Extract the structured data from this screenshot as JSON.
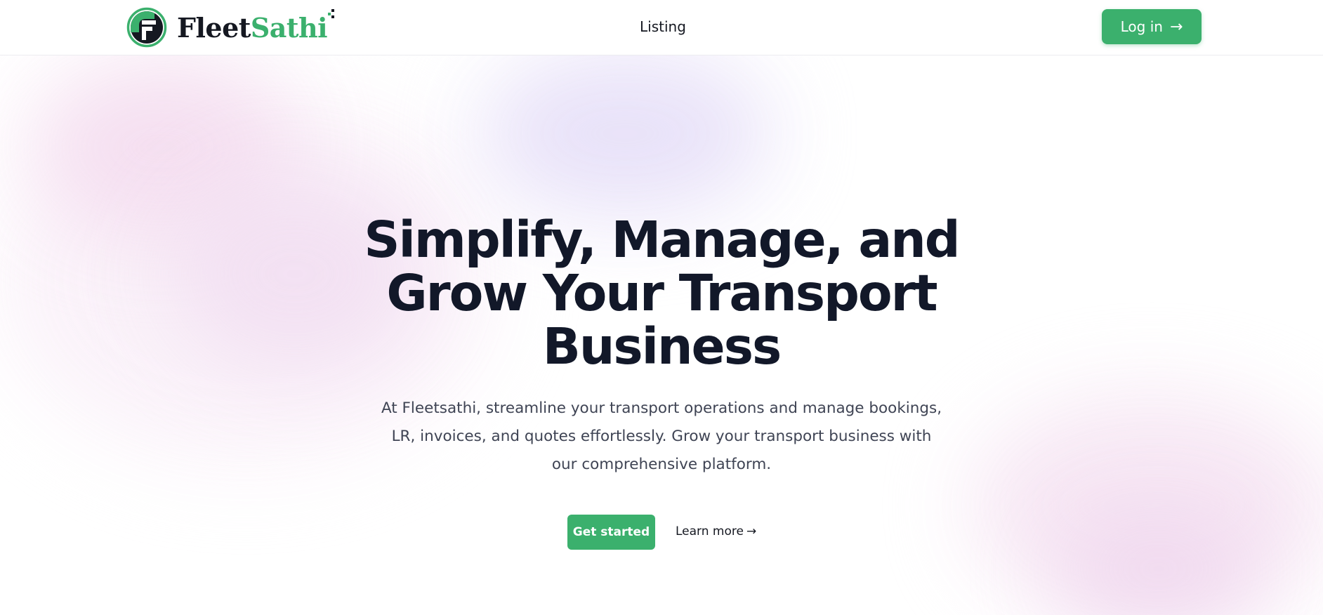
{
  "brand": {
    "name_part1": "Fleet",
    "name_part2": "Sathi",
    "primary_color": "#3bb06d",
    "dark_color": "#151821"
  },
  "nav": {
    "listing_label": "Listing",
    "login_label": "Log in",
    "login_arrow": "→"
  },
  "hero": {
    "title": "Simplify, Manage, and Grow Your Transport Business",
    "subtitle": "At Fleetsathi, streamline your transport operations and manage bookings, LR, invoices, and quotes effortlessly. Grow your transport business with our comprehensive platform.",
    "primary_cta": "Get started",
    "secondary_cta": "Learn more",
    "secondary_arrow": "→"
  },
  "icons": {
    "logo": "fleetsathi-logo-icon",
    "login_arrow": "arrow-right-icon",
    "learn_more_arrow": "arrow-right-icon"
  }
}
